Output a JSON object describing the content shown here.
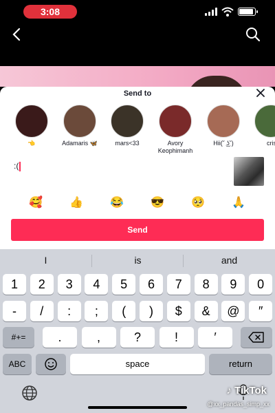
{
  "status_bar": {
    "time": "3:08"
  },
  "sheet": {
    "title": "Send to",
    "contacts": [
      {
        "name": "👈",
        "color": "#3a1a1a"
      },
      {
        "name": "Adamaris 🦋",
        "color": "#6b4a3a"
      },
      {
        "name": "mars<33",
        "color": "#3b3328"
      },
      {
        "name": "Avory Keophimanh",
        "color": "#7a2a2a"
      },
      {
        "name": "Hii(˘ ͜ʖ˘)",
        "color": "#a66a55"
      },
      {
        "name": "cris",
        "color": "#4a6a3a"
      }
    ],
    "message_text": ":(",
    "emojis": [
      "🥰",
      "👍",
      "😂",
      "😎",
      "🥺",
      "🙏"
    ],
    "send_label": "Send",
    "accent_color": "#fe2c55"
  },
  "keyboard": {
    "suggestions": [
      "I",
      "is",
      "and"
    ],
    "row1": [
      "1",
      "2",
      "3",
      "4",
      "5",
      "6",
      "7",
      "8",
      "9",
      "0"
    ],
    "row2": [
      "-",
      "/",
      ":",
      ";",
      "(",
      ")",
      "$",
      "&",
      "@",
      "″"
    ],
    "row3_left": "#+=",
    "row3": [
      ".",
      ",",
      "?",
      "!",
      "′"
    ],
    "abc": "ABC",
    "space": "space",
    "return": "return"
  },
  "watermark": {
    "brand": "TikTok",
    "handle": "@xx_pandas_simp_xx"
  }
}
